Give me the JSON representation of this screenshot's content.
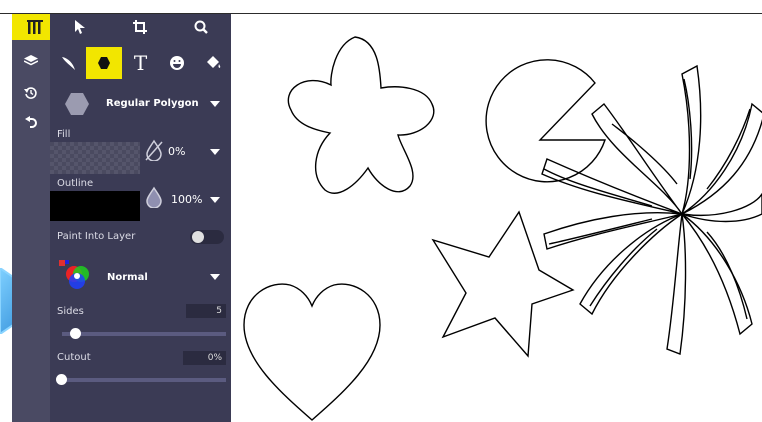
{
  "toolbar": {
    "tools_icon": "tools-icon",
    "pointer_icon": "pointer-icon",
    "crop_icon": "crop-icon",
    "search_icon": "search-icon",
    "brush_icon": "brush-icon",
    "shape_icon": "hexagon-icon",
    "text_icon_label": "T",
    "emoji_icon": "emoji-icon",
    "fill_bucket_icon": "paint-bucket-icon"
  },
  "rail": {
    "items": [
      "layers-icon",
      "history-icon",
      "undo-icon"
    ]
  },
  "shape": {
    "selected": "Regular Polygon"
  },
  "fill": {
    "label": "Fill",
    "opacity": "0%"
  },
  "outline": {
    "label": "Outline",
    "opacity": "100%"
  },
  "paint_into_layer": {
    "label": "Paint Into Layer",
    "enabled": false
  },
  "blend": {
    "mode": "Normal"
  },
  "sides": {
    "label": "Sides",
    "value": "5",
    "level": 0.05
  },
  "cutout": {
    "label": "Cutout",
    "value": "0%",
    "level": 0
  },
  "colors": {
    "accent": "#f2e600",
    "rail": "#4a4a63",
    "panel": "#3b3b55",
    "callout": "#3aa6e8"
  }
}
